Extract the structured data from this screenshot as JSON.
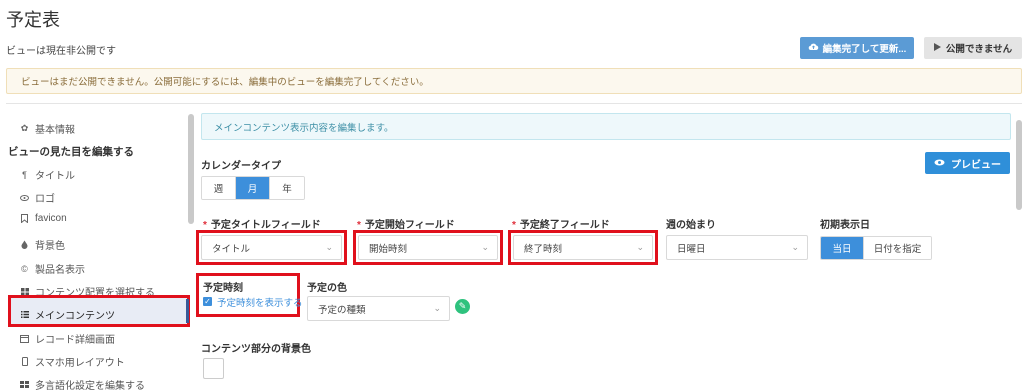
{
  "page": {
    "title": "予定表",
    "status": "ビューは現在非公開です"
  },
  "actions": {
    "finish_label": "編集完了して更新...",
    "publish_label": "公開できません"
  },
  "warning": "ビューはまだ公開できません。公開可能にするには、編集中のビューを編集完了してください。",
  "sidebar": {
    "basic_info": "基本情報",
    "heading": "ビューの見た目を編集する",
    "items": [
      {
        "label": "タイトル",
        "icon": "paragraph-icon"
      },
      {
        "label": "ロゴ",
        "icon": "eye-icon"
      },
      {
        "label": "favicon",
        "icon": "bookmark-icon"
      },
      {
        "label": "背景色",
        "icon": "drop-icon"
      },
      {
        "label": "製品名表示",
        "icon": "copyright-icon"
      },
      {
        "label": "コンテンツ配置を選択する",
        "icon": "grid-icon"
      },
      {
        "label": "メインコンテンツ",
        "icon": "list-icon",
        "active": true
      },
      {
        "label": "レコード詳細画面",
        "icon": "window-icon"
      },
      {
        "label": "スマホ用レイアウト",
        "icon": "mobile-icon"
      },
      {
        "label": "多言語化設定を編集する",
        "icon": "table-icon"
      }
    ]
  },
  "main": {
    "info": "メインコンテンツ表示内容を編集します。",
    "calendar_type": {
      "label": "カレンダータイプ",
      "options": [
        "週",
        "月",
        "年"
      ],
      "selected": "月"
    },
    "preview_label": "プレビュー",
    "fields": {
      "title": {
        "label": "予定タイトルフィールド",
        "value": "タイトル",
        "required": "*"
      },
      "start": {
        "label": "予定開始フィールド",
        "value": "開始時刻",
        "required": "*"
      },
      "end": {
        "label": "予定終了フィールド",
        "value": "終了時刻",
        "required": "*"
      },
      "week_start": {
        "label": "週の始まり",
        "value": "日曜日"
      },
      "initial": {
        "label": "初期表示日",
        "options": [
          "当日",
          "日付を指定"
        ],
        "selected": "当日"
      }
    },
    "time": {
      "label": "予定時刻",
      "checkbox_label": "予定時刻を表示する",
      "checked": true
    },
    "color": {
      "label": "予定の色",
      "value": "予定の種類"
    },
    "bg": {
      "label": "コンテンツ部分の背景色"
    }
  },
  "colors": {
    "accent": "#3d8fdb",
    "highlight": "#e0101c",
    "warning_bg": "#fcf8ee",
    "info_bg": "#eef8fb"
  }
}
